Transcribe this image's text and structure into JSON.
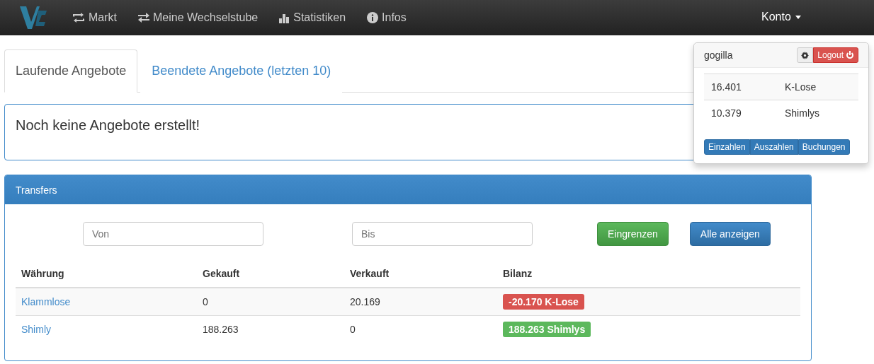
{
  "navbar": {
    "items": [
      {
        "label": "Markt"
      },
      {
        "label": "Meine Wechselstube"
      },
      {
        "label": "Statistiken"
      },
      {
        "label": "Infos"
      }
    ],
    "account": {
      "label": "Konto",
      "expanded": true
    }
  },
  "account_menu": {
    "user": "gogilla",
    "logout": "Logout",
    "balances": [
      {
        "amount": "16.401",
        "currency": "K-Lose"
      },
      {
        "amount": "10.379",
        "currency": "Shimlys"
      }
    ],
    "buttons": [
      "Einzahlen",
      "Auszahlen",
      "Buchungen"
    ]
  },
  "tabs": [
    {
      "label": "Laufende Angebote",
      "selected": true
    },
    {
      "label": "Beendete Angebote (letzten 10)",
      "selected": false
    }
  ],
  "notice": "Noch keine Angebote erstellt!",
  "transfers": {
    "title": "Transfers",
    "from": {
      "placeholder": "Von"
    },
    "to": {
      "placeholder": "Bis"
    },
    "filter_button": "Eingrenzen",
    "all_button": "Alle anzeigen",
    "columns": [
      "Währung",
      "Gekauft",
      "Verkauft",
      "Bilanz"
    ],
    "rows": [
      {
        "currency": "Klammlose",
        "bought": "0",
        "sold": "20.169",
        "balance": "-20.170 K-Lose",
        "color": "#d9534f"
      },
      {
        "currency": "Shimly",
        "bought": "188.263",
        "sold": "0",
        "balance": "188.263 Shimlys",
        "color": "#5cb85c"
      }
    ]
  }
}
